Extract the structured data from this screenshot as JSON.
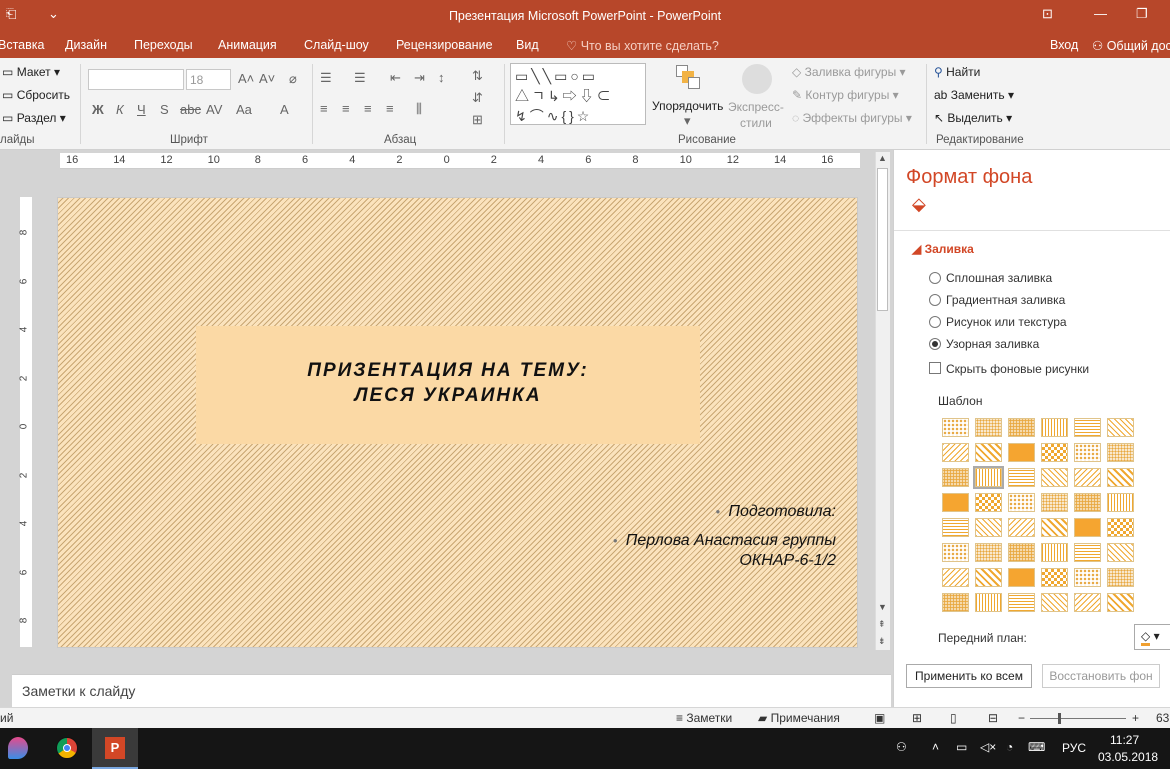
{
  "window": {
    "title": "Презентация Microsoft PowerPoint - PowerPoint"
  },
  "tabs": [
    "Вставка",
    "Дизайн",
    "Переходы",
    "Анимация",
    "Слайд-шоу",
    "Рецензирование",
    "Вид"
  ],
  "tell_me": "Что вы хотите сделать?",
  "account": {
    "login": "Вход",
    "share": "Общий дос"
  },
  "ribbon": {
    "slides": {
      "layout": "Макет",
      "reset": "Сбросить",
      "section": "Раздел",
      "label": "лайды"
    },
    "font": {
      "name": "",
      "size": "18",
      "label": "Шрифт"
    },
    "paragraph": {
      "label": "Абзац"
    },
    "drawing": {
      "arrange": "Упорядочить",
      "quick_styles": "Экспресс-\nстили",
      "fill": "Заливка фигуры",
      "outline": "Контур фигуры",
      "effects": "Эффекты фигуры",
      "label": "Рисование"
    },
    "editing": {
      "find": "Найти",
      "replace": "Заменить",
      "select": "Выделить",
      "label": "Редактирование"
    }
  },
  "slide": {
    "title_line1": "ПРИЗЕНТАЦИЯ НА ТЕМУ:",
    "title_line2": "ЛЕСЯ УКРАИНКА",
    "sub1": "Подготовила:",
    "sub2_line1": "Перлова Анастасия группы",
    "sub2_line2": "ОКНАР-6-1/2"
  },
  "ruler": {
    "h": [
      "16",
      "14",
      "12",
      "10",
      "8",
      "6",
      "4",
      "2",
      "0",
      "2",
      "4",
      "6",
      "8",
      "10",
      "12",
      "14",
      "16"
    ],
    "v": [
      "8",
      "6",
      "4",
      "2",
      "0",
      "2",
      "4",
      "6",
      "8"
    ]
  },
  "notes_placeholder": "Заметки к слайду",
  "pane": {
    "title": "Формат фона",
    "section": "Заливка",
    "options": [
      "Сплошная заливка",
      "Градиентная заливка",
      "Рисунок или текстура",
      "Узорная заливка"
    ],
    "selected": 3,
    "hide_bg": "Скрыть фоновые рисунки",
    "pattern_label": "Шаблон",
    "foreground": "Передний план:",
    "apply_all": "Применить ко всем",
    "reset_bg": "Восстановить фон",
    "accent": "#d24726"
  },
  "status": {
    "left": "ий",
    "notes": "Заметки",
    "comments": "Примечания",
    "zoom": "63"
  },
  "taskbar": {
    "lang": "РУС",
    "time": "11:27",
    "date": "03.05.2018"
  }
}
